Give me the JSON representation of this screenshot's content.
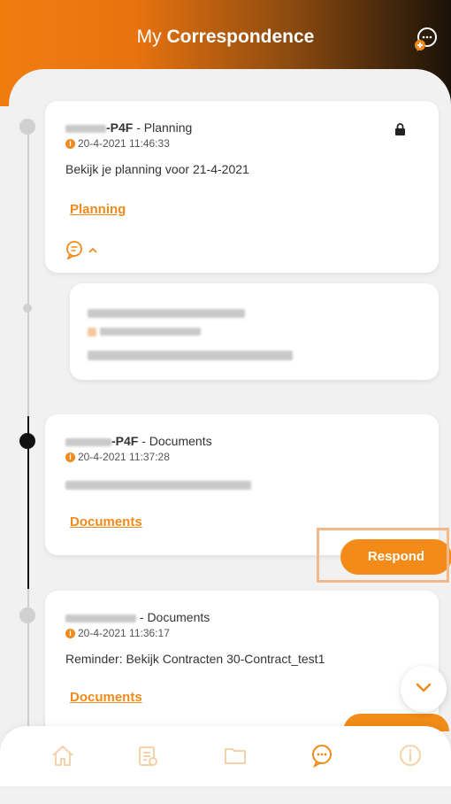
{
  "header": {
    "title_prefix": "My",
    "title_bold": "Correspondence"
  },
  "items": [
    {
      "sender_suffix": "-P4F",
      "category": " - Planning",
      "timestamp": "20-4-2021 11:46:33",
      "message": "Bekijk je planning voor 21-4-2021",
      "link": "Planning",
      "locked": true
    },
    {
      "sender_suffix": "-P4F",
      "category": " - Documents",
      "timestamp": "20-4-2021 11:37:28",
      "link": "Documents",
      "action": "Respond"
    },
    {
      "category": " - Documents",
      "timestamp": "20-4-2021 11:36:17",
      "message": "Reminder: Bekijk Contracten 30-Contract_test1",
      "link": "Documents"
    }
  ],
  "icons": {
    "accent": "#f08a1c",
    "header_action": "chat-plus-icon",
    "nav": [
      "home-icon",
      "clipboard-icon",
      "folder-icon",
      "chat-icon",
      "info-icon"
    ]
  }
}
